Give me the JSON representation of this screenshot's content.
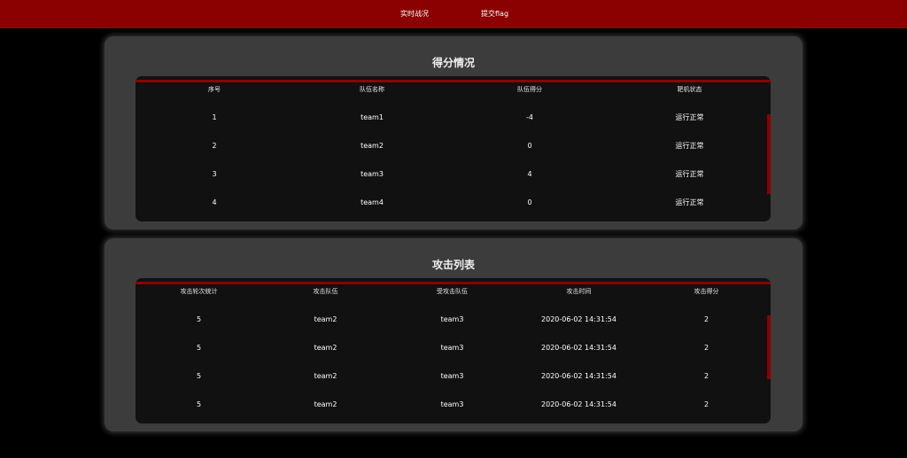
{
  "nav": {
    "items": [
      "实时战况",
      "提交flag"
    ]
  },
  "score": {
    "title": "得分情况",
    "headers": [
      "序号",
      "队伍名称",
      "队伍得分",
      "靶机状态"
    ],
    "rows": [
      [
        "1",
        "team1",
        "-4",
        "运行正常"
      ],
      [
        "2",
        "team2",
        "0",
        "运行正常"
      ],
      [
        "3",
        "team3",
        "4",
        "运行正常"
      ],
      [
        "4",
        "team4",
        "0",
        "运行正常"
      ]
    ]
  },
  "attack": {
    "title": "攻击列表",
    "headers": [
      "攻击轮次统计",
      "攻击队伍",
      "受攻击队伍",
      "攻击时间",
      "攻击得分"
    ],
    "rows": [
      [
        "5",
        "team2",
        "team3",
        "2020-06-02 14:31:54",
        "2"
      ],
      [
        "5",
        "team2",
        "team3",
        "2020-06-02 14:31:54",
        "2"
      ],
      [
        "5",
        "team2",
        "team3",
        "2020-06-02 14:31:54",
        "2"
      ],
      [
        "5",
        "team2",
        "team3",
        "2020-06-02 14:31:54",
        "2"
      ]
    ]
  },
  "colors": {
    "accent": "#8b0000",
    "panel": "#3c3c3c",
    "table": "#111111",
    "background": "#000000"
  }
}
